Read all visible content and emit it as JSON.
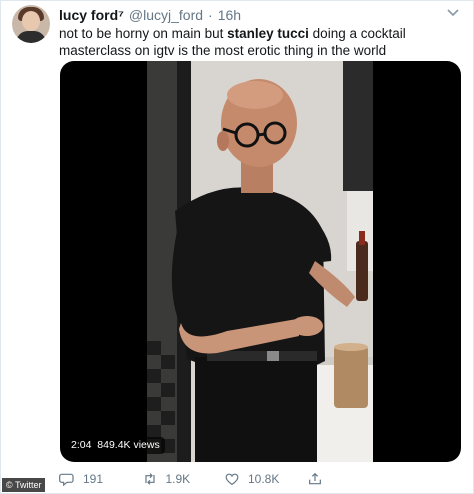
{
  "tweet": {
    "author_name": "lucy ford⁷",
    "handle": "@lucyj_ford",
    "separator": "·",
    "time": "16h",
    "text_before": "not to be horny on main but ",
    "text_bold": "stanley tucci",
    "text_after": " doing a cocktail masterclass on igtv is the most erotic thing in the world"
  },
  "video": {
    "duration": "2:04",
    "views": "849.4K views"
  },
  "actions": {
    "replies": "191",
    "retweets": "1.9K",
    "likes": "10.8K"
  },
  "icons": {
    "menu": "chevron-down-icon",
    "reply": "reply-icon",
    "retweet": "retweet-icon",
    "like": "heart-icon",
    "share": "share-icon"
  },
  "watermark": "© Twitter",
  "colors": {
    "text": "#14171a",
    "secondary": "#657786",
    "border": "#e1e8ed"
  }
}
